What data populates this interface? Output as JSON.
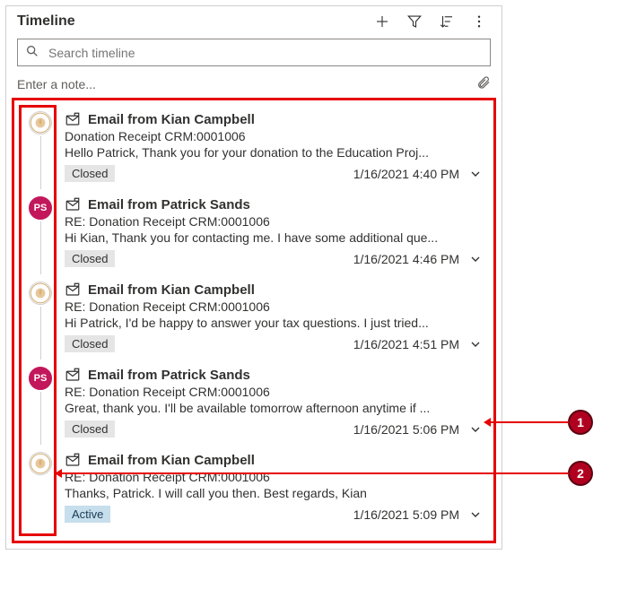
{
  "header": {
    "title": "Timeline"
  },
  "search": {
    "placeholder": "Search timeline"
  },
  "note": {
    "placeholder": "Enter a note..."
  },
  "callouts": {
    "one": "1",
    "two": "2"
  },
  "items": [
    {
      "avatar_type": "kc",
      "avatar_text": "",
      "title": "Email from Kian Campbell",
      "subject": "Donation Receipt CRM:0001006",
      "preview": "Hello Patrick,   Thank you for your donation to the Education Proj...",
      "status_label": "Closed",
      "status_kind": "closed",
      "timestamp": "1/16/2021 4:40 PM"
    },
    {
      "avatar_type": "ps",
      "avatar_text": "PS",
      "title": "Email from Patrick Sands",
      "subject": "RE: Donation Receipt CRM:0001006",
      "preview": "Hi Kian, Thank you for contacting me. I have some additional que...",
      "status_label": "Closed",
      "status_kind": "closed",
      "timestamp": "1/16/2021 4:46 PM"
    },
    {
      "avatar_type": "kc",
      "avatar_text": "",
      "title": "Email from Kian Campbell",
      "subject": "RE: Donation Receipt CRM:0001006",
      "preview": "Hi Patrick,   I'd be happy to answer your tax questions. I just tried...",
      "status_label": "Closed",
      "status_kind": "closed",
      "timestamp": "1/16/2021 4:51 PM"
    },
    {
      "avatar_type": "ps",
      "avatar_text": "PS",
      "title": "Email from Patrick Sands",
      "subject": "RE: Donation Receipt CRM:0001006",
      "preview": "Great, thank you. I'll be available tomorrow afternoon anytime if ...",
      "status_label": "Closed",
      "status_kind": "closed",
      "timestamp": "1/16/2021 5:06 PM"
    },
    {
      "avatar_type": "kc",
      "avatar_text": "",
      "title": "Email from Kian Campbell",
      "subject": "RE: Donation Receipt CRM:0001006",
      "preview": "Thanks, Patrick. I will call you then.   Best regards, Kian",
      "status_label": "Active",
      "status_kind": "active",
      "timestamp": "1/16/2021 5:09 PM"
    }
  ]
}
